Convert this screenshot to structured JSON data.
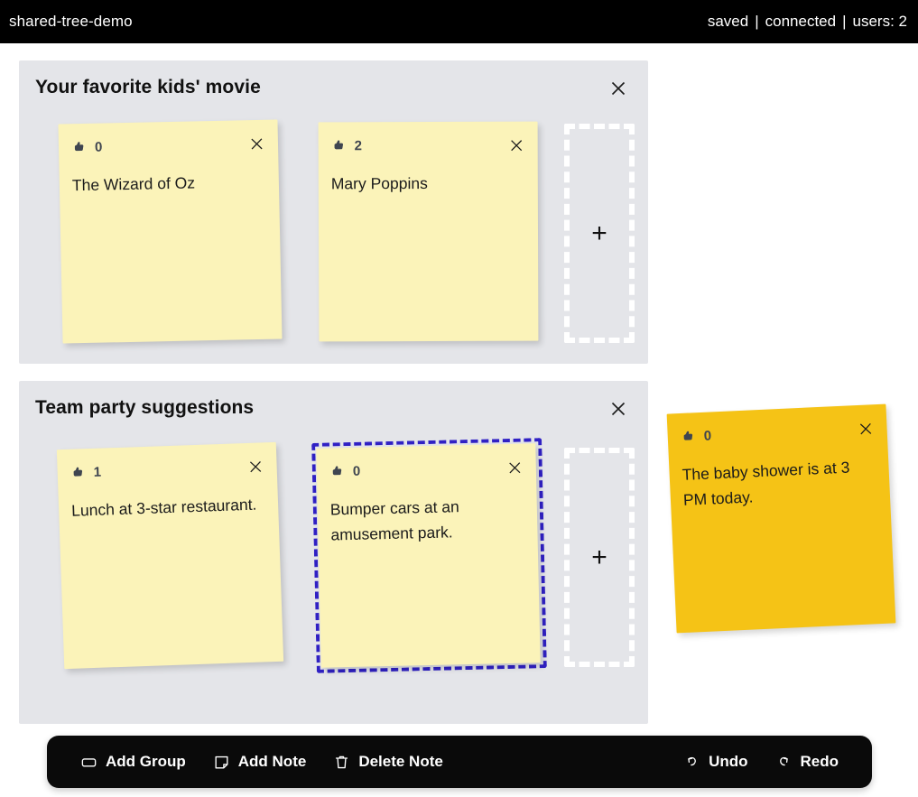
{
  "header": {
    "title": "shared-tree-demo",
    "save_status": "saved",
    "connection_status": "connected",
    "users_label": "users: 2",
    "separator": "|"
  },
  "groups": [
    {
      "title": "Your favorite kids' movie",
      "close_icon": "close-icon",
      "notes": [
        {
          "vote_icon": "thumbs-up-icon",
          "votes": "0",
          "text": "The Wizard of Oz",
          "close_icon": "close-icon",
          "selected": false,
          "color": "#fbf3b9",
          "rotation": "-1.2deg"
        },
        {
          "vote_icon": "thumbs-up-icon",
          "votes": "2",
          "text": "Mary Poppins",
          "close_icon": "close-icon",
          "selected": false,
          "color": "#fbf3b9",
          "rotation": "-0.2deg"
        }
      ],
      "add_note_placeholder": {
        "icon": "plus-icon",
        "label": "+"
      }
    },
    {
      "title": "Team party suggestions",
      "close_icon": "close-icon",
      "notes": [
        {
          "vote_icon": "thumbs-up-icon",
          "votes": "1",
          "text": "Lunch at 3-star restaurant.",
          "close_icon": "close-icon",
          "selected": false,
          "color": "#fbf3b9",
          "rotation": "-2deg"
        },
        {
          "vote_icon": "thumbs-up-icon",
          "votes": "0",
          "text": "Bumper cars at an amusement park.",
          "close_icon": "close-icon",
          "selected": true,
          "color": "#fbf3b9",
          "rotation": "-1.3deg"
        }
      ],
      "add_note_placeholder": {
        "icon": "plus-icon",
        "label": "+"
      }
    }
  ],
  "floating_note": {
    "vote_icon": "thumbs-up-icon",
    "votes": "0",
    "text": "The baby shower is at 3 PM today.",
    "close_icon": "close-icon",
    "color": "#f5c316",
    "rotation": "-2.6deg"
  },
  "toolbar": {
    "add_group_label": "Add Group",
    "add_group_icon": "rounded-rectangle-icon",
    "add_note_label": "Add Note",
    "add_note_icon": "note-icon",
    "delete_note_label": "Delete Note",
    "delete_note_icon": "trash-icon",
    "undo_label": "Undo",
    "undo_icon": "undo-arrow-icon",
    "redo_label": "Redo",
    "redo_icon": "redo-arrow-icon"
  },
  "colors": {
    "topbar_background": "#000000",
    "page_background": "#ffffff",
    "group_background": "#e4e5e9",
    "note_yellow": "#fbf3b9",
    "note_amber": "#f5c316",
    "selection_blue": "#3021c4",
    "toolbar_background": "#0a0a0a"
  }
}
